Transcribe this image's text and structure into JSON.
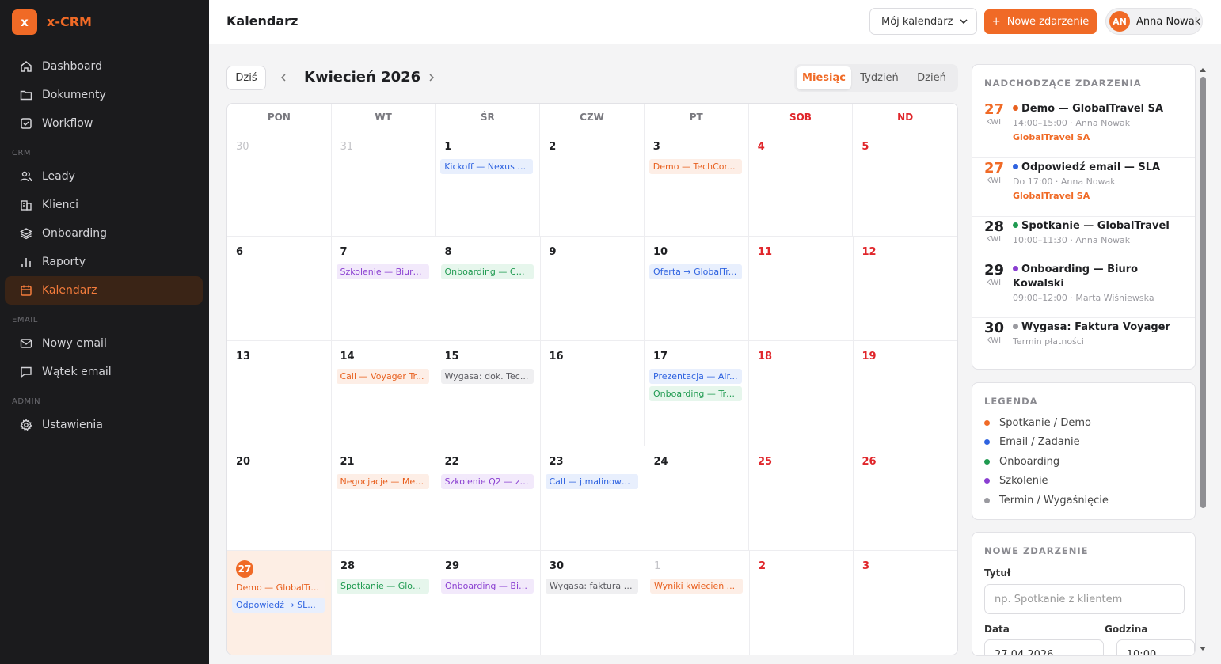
{
  "brand": {
    "logo": "x",
    "name": "x-CRM"
  },
  "sidebar": {
    "items": [
      {
        "label": "Dashboard",
        "icon": "home-icon"
      },
      {
        "label": "Dokumenty",
        "icon": "folder-icon"
      },
      {
        "label": "Workflow",
        "icon": "checkbox-icon"
      }
    ],
    "crm_label": "CRM",
    "crm_items": [
      {
        "label": "Leady",
        "icon": "users-icon"
      },
      {
        "label": "Klienci",
        "icon": "building-icon"
      },
      {
        "label": "Onboarding",
        "icon": "layers-icon"
      },
      {
        "label": "Raporty",
        "icon": "bar-chart-icon"
      },
      {
        "label": "Kalendarz",
        "icon": "calendar-icon"
      }
    ],
    "email_label": "EMAIL",
    "email_items": [
      {
        "label": "Nowy email",
        "icon": "mail-icon"
      },
      {
        "label": "Wątek email",
        "icon": "message-icon"
      }
    ],
    "admin_label": "ADMIN",
    "admin_items": [
      {
        "label": "Ustawienia",
        "icon": "gear-icon"
      }
    ]
  },
  "header": {
    "title": "Kalendarz",
    "calendar_select": "Mój kalendarz",
    "new_event_button": "Nowe zdarzenie",
    "user": {
      "initials": "AN",
      "name": "Anna Nowak"
    }
  },
  "toolbar": {
    "today": "Dziś",
    "month_title": "Kwiecień 2026",
    "views": [
      "Miesiąc",
      "Tydzień",
      "Dzień"
    ],
    "active_view": "Miesiąc"
  },
  "calendar": {
    "weekdays": [
      "PON",
      "WT",
      "ŚR",
      "CZW",
      "PT",
      "SOB",
      "ND"
    ],
    "weeks": [
      [
        {
          "day": "30",
          "other": true,
          "events": []
        },
        {
          "day": "31",
          "other": true,
          "events": []
        },
        {
          "day": "1",
          "events": [
            {
              "label": "Kickoff — Nexus E...",
              "color": "blue"
            }
          ]
        },
        {
          "day": "2",
          "events": []
        },
        {
          "day": "3",
          "events": [
            {
              "label": "Demo — TechCor...",
              "color": "orange"
            }
          ]
        },
        {
          "day": "4",
          "weekend": true,
          "events": []
        },
        {
          "day": "5",
          "weekend": true,
          "events": []
        }
      ],
      [
        {
          "day": "6",
          "events": []
        },
        {
          "day": "7",
          "events": [
            {
              "label": "Szkolenie — Biuro ...",
              "color": "purple"
            }
          ]
        },
        {
          "day": "8",
          "events": [
            {
              "label": "Onboarding — Co...",
              "color": "green"
            }
          ]
        },
        {
          "day": "9",
          "events": []
        },
        {
          "day": "10",
          "events": [
            {
              "label": "Oferta → GlobalTr...",
              "color": "blue"
            }
          ]
        },
        {
          "day": "11",
          "weekend": true,
          "events": []
        },
        {
          "day": "12",
          "weekend": true,
          "events": []
        }
      ],
      [
        {
          "day": "13",
          "events": []
        },
        {
          "day": "14",
          "events": [
            {
              "label": "Call — Voyager Tr...",
              "color": "orange"
            }
          ]
        },
        {
          "day": "15",
          "events": [
            {
              "label": "Wygasa: dok. Tec...",
              "color": "gray"
            }
          ]
        },
        {
          "day": "16",
          "events": []
        },
        {
          "day": "17",
          "events": [
            {
              "label": "Prezentacja — Air...",
              "color": "blue"
            },
            {
              "label": "Onboarding — Tra...",
              "color": "green"
            }
          ]
        },
        {
          "day": "18",
          "weekend": true,
          "events": []
        },
        {
          "day": "19",
          "weekend": true,
          "events": []
        }
      ],
      [
        {
          "day": "20",
          "events": []
        },
        {
          "day": "21",
          "events": [
            {
              "label": "Negocjacje — Mer...",
              "color": "orange"
            }
          ]
        },
        {
          "day": "22",
          "events": [
            {
              "label": "Szkolenie Q2 — ze...",
              "color": "purple"
            }
          ]
        },
        {
          "day": "23",
          "events": [
            {
              "label": "Call — j.malinows...",
              "color": "blue"
            }
          ]
        },
        {
          "day": "24",
          "events": []
        },
        {
          "day": "25",
          "weekend": true,
          "events": []
        },
        {
          "day": "26",
          "weekend": true,
          "events": []
        }
      ],
      [
        {
          "day": "27",
          "today": true,
          "events": [
            {
              "label": "Demo — GlobalTr...",
              "color": "orange"
            },
            {
              "label": "Odpowiedź → SL...",
              "color": "blue"
            }
          ]
        },
        {
          "day": "28",
          "events": [
            {
              "label": "Spotkanie — Glob...",
              "color": "green"
            }
          ]
        },
        {
          "day": "29",
          "events": [
            {
              "label": "Onboarding — Biu...",
              "color": "purple"
            }
          ]
        },
        {
          "day": "30",
          "events": [
            {
              "label": "Wygasa: faktura V...",
              "color": "gray"
            }
          ]
        },
        {
          "day": "1",
          "other": true,
          "events": [
            {
              "label": "Wyniki kwiecień ...",
              "color": "orange"
            }
          ]
        },
        {
          "day": "2",
          "weekend": true,
          "events": []
        },
        {
          "day": "3",
          "weekend": true,
          "events": []
        }
      ]
    ]
  },
  "upcoming": {
    "title": "NADCHODZĄCE ZDARZENIA",
    "items": [
      {
        "day": "27",
        "month": "KWI",
        "title": "Demo — GlobalTravel SA",
        "meta": "14:00–15:00 · Anna Nowak",
        "client": "GlobalTravel SA",
        "color": "orange"
      },
      {
        "day": "27",
        "month": "KWI",
        "title": "Odpowiedź email — SLA",
        "meta": "Do 17:00 · Anna Nowak",
        "client": "GlobalTravel SA",
        "color": "blue"
      },
      {
        "day": "28",
        "month": "KWI",
        "title": "Spotkanie — GlobalTravel",
        "meta": "10:00–11:30 · Anna Nowak",
        "client": "",
        "color": "green"
      },
      {
        "day": "29",
        "month": "KWI",
        "title": "Onboarding — Biuro Kowalski",
        "meta": "09:00–12:00 · Marta Wiśniewska",
        "client": "",
        "color": "purple"
      },
      {
        "day": "30",
        "month": "KWI",
        "title": "Wygasa: Faktura Voyager",
        "meta": "Termin płatności",
        "client": "",
        "color": "gray"
      }
    ]
  },
  "legend": {
    "title": "LEGENDA",
    "items": [
      {
        "label": "Spotkanie / Demo",
        "color": "#f06a26"
      },
      {
        "label": "Email / Zadanie",
        "color": "#2f63e0"
      },
      {
        "label": "Onboarding",
        "color": "#1f9a50"
      },
      {
        "label": "Szkolenie",
        "color": "#8a3fd1"
      },
      {
        "label": "Termin / Wygaśnięcie",
        "color": "#9a9aa0"
      }
    ]
  },
  "new_event": {
    "title": "NOWE ZDARZENIE",
    "title_label": "Tytuł",
    "title_placeholder": "np. Spotkanie z klientem",
    "date_label": "Data",
    "date_value": "27.04.2026",
    "time_label": "Godzina",
    "time_value": "10:00"
  },
  "colors": {
    "accent": "#f06a26",
    "orange": "#e8601f",
    "blue": "#2f63e0",
    "green": "#1f9a50",
    "purple": "#8a3fd1",
    "gray": "#9a9aa0"
  }
}
